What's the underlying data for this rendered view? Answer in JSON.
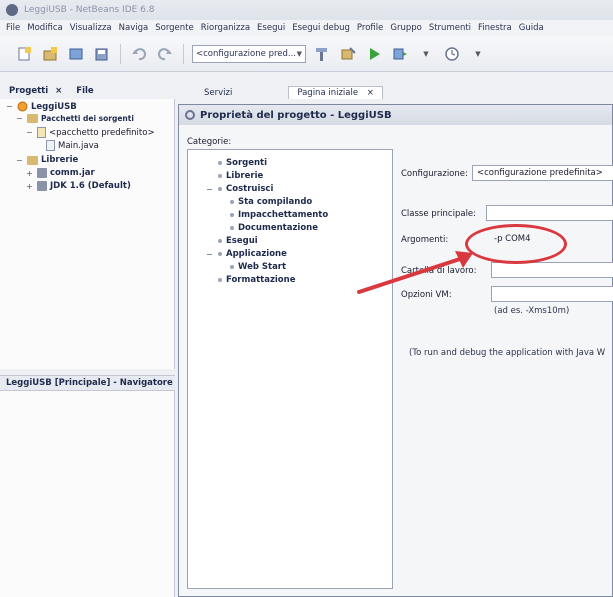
{
  "window": {
    "title": "LeggiUSB - NetBeans IDE 6.8"
  },
  "menubar": {
    "items": [
      "File",
      "Modifica",
      "Visualizza",
      "Naviga",
      "Sorgente",
      "Riorganizza",
      "Esegui",
      "Esegui debug",
      "Profile",
      "Gruppo",
      "Strumenti",
      "Finestra",
      "Guida"
    ]
  },
  "toolbar": {
    "config_value": "<configurazione pred..."
  },
  "left_tabs": {
    "projects": "Progetti",
    "files": "File",
    "close": "×"
  },
  "editor_tabs": {
    "services": "Servizi",
    "start_page": "Pagina iniziale",
    "close": "×"
  },
  "project_tree": {
    "root": "LeggiUSB",
    "source_packages": "Pacchetti dei sorgenti",
    "default_package": "<pacchetto predefinito>",
    "main_file": "Main.java",
    "libraries": "Librerie",
    "comm_jar": "comm.jar",
    "jdk": "JDK 1.6 (Default)"
  },
  "navigator": {
    "title": "LeggiUSB [Principale] - Navigatore"
  },
  "dialog": {
    "title": "Proprietà del progetto - LeggiUSB",
    "categories_label": "Categorie:",
    "categories": {
      "sorgenti": "Sorgenti",
      "librerie": "Librerie",
      "costruisci": "Costruisci",
      "sta_compilando": "Sta compilando",
      "impacchettamento": "Impacchettamento",
      "documentazione": "Documentazione",
      "esegui": "Esegui",
      "applicazione": "Applicazione",
      "web_start": "Web Start",
      "formattazione": "Formattazione"
    },
    "configurazione_label": "Configurazione:",
    "configurazione_value": "<configurazione predefinita>",
    "classe_principale_label": "Classe principale:",
    "argomenti_label": "Argomenti:",
    "argomenti_value": "-p COM4",
    "cartella_label": "Cartella di lavoro:",
    "opzioni_vm_label": "Opzioni VM:",
    "vm_hint": "(ad es. -Xms10m)",
    "run_hint": "(To run and debug the application with Java W"
  },
  "annotation": {
    "circle_color": "#d9383f",
    "arrow_color": "#d9383f"
  }
}
